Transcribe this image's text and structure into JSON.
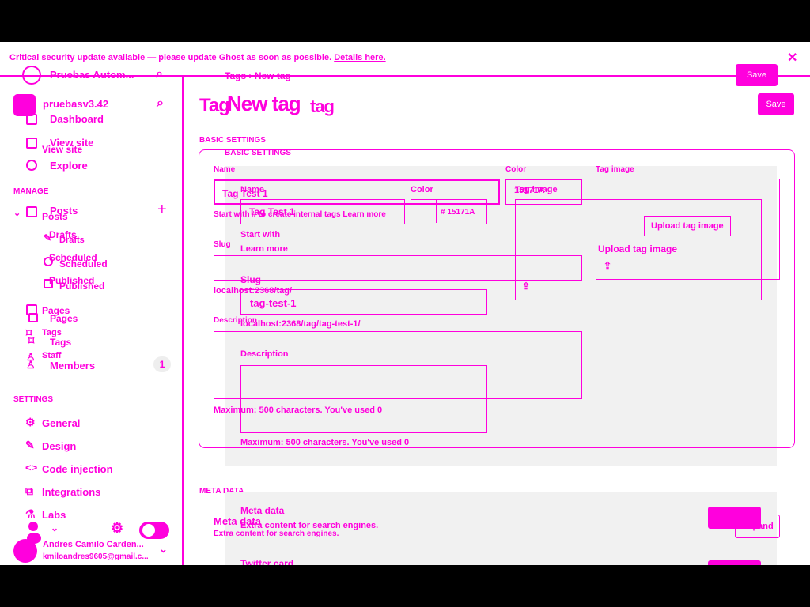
{
  "banner": {
    "text": "Critical security update available — please update Ghost as soon as possible.",
    "link": "Details here.",
    "close_icon": "close-icon"
  },
  "sidebar": {
    "site_name": "Pruebas Autom...",
    "site_name_2": "pruebasv3.42",
    "nav": [
      {
        "label": "Dashboard",
        "icon": "home-icon"
      },
      {
        "label": "View site",
        "icon": "monitor-icon"
      },
      {
        "label": "View site"
      },
      {
        "label": "Explore",
        "icon": "globe-icon"
      }
    ],
    "manage_heading": "MANAGE",
    "posts": {
      "label": "Posts",
      "label_2": "Posts"
    },
    "sub": [
      {
        "label": "Drafts",
        "label_2": "Drafts"
      },
      {
        "label": "Scheduled",
        "label_2": "Scheduled"
      },
      {
        "label": "Published",
        "label_2": "Published"
      }
    ],
    "pages": {
      "label": "Pages",
      "label_2": "Pages"
    },
    "tags": {
      "label": "Tags",
      "label_2": "Tags"
    },
    "staff": {
      "label": "Staff"
    },
    "members": {
      "label": "Members",
      "count": "1"
    },
    "settings_heading": "SETTINGS",
    "settings": [
      {
        "label": "General"
      },
      {
        "label": "Design"
      },
      {
        "label": "Code injection"
      },
      {
        "label": "Integrations"
      },
      {
        "label": "Labs"
      }
    ],
    "user": {
      "name": "Andres Camilo Carden...",
      "email": "kmiloandres9605@gmail.c..."
    }
  },
  "header": {
    "breadcrumb_root": "Tags",
    "breadcrumb_sep": "›",
    "breadcrumb_current": "New tag",
    "title_a": "Tag",
    "title_b": "New tag",
    "title_c": "tag",
    "save_label": "Save"
  },
  "basic": {
    "heading": "BASIC SETTINGS",
    "name_label": "Name",
    "name_value": "Tag Test 1",
    "name_hint": "Start with # to create internal tags",
    "name_hint_link": "Learn more",
    "hint_prefix": "Start with",
    "color_label": "Color",
    "color_value": "15171A",
    "color_hash": "#",
    "image_label": "Tag image",
    "upload_label": "Upload tag image",
    "slug_label": "Slug",
    "slug_value": "tag-test-1",
    "slug_url": "localhost:2368/tag/tag-test-1/",
    "slug_url_short": "localhost:2368/tag/",
    "desc_label": "Description",
    "desc_hint": "Maximum: 500 characters. You've used 0"
  },
  "meta": {
    "heading": "META DATA",
    "title": "Meta data",
    "sub": "Extra content for search engines.",
    "expand": "Expand",
    "twitter": "Twitter card"
  }
}
